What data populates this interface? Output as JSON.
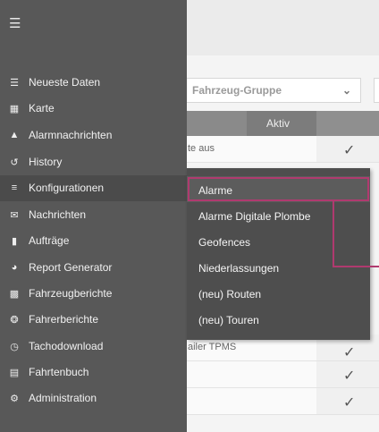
{
  "sidebar": {
    "menu_icon": "hamburger-icon",
    "items": [
      {
        "label": "Neueste Daten",
        "icon": "list-icon"
      },
      {
        "label": "Karte",
        "icon": "map-icon"
      },
      {
        "label": "Alarmnachrichten",
        "icon": "warning-icon"
      },
      {
        "label": "History",
        "icon": "history-icon"
      },
      {
        "label": "Konfigurationen",
        "icon": "sliders-icon"
      },
      {
        "label": "Nachrichten",
        "icon": "mail-icon"
      },
      {
        "label": "Aufträge",
        "icon": "document-icon"
      },
      {
        "label": "Report Generator",
        "icon": "pie-chart-icon"
      },
      {
        "label": "Fahrzeugberichte",
        "icon": "truck-icon"
      },
      {
        "label": "Fahrerberichte",
        "icon": "steering-wheel-icon"
      },
      {
        "label": "Tachodownload",
        "icon": "tacho-icon"
      },
      {
        "label": "Fahrtenbuch",
        "icon": "book-icon"
      },
      {
        "label": "Administration",
        "icon": "gear-icon"
      }
    ]
  },
  "submenu": {
    "items": [
      "Alarme",
      "Alarme Digitale Plombe",
      "Geofences",
      "Niederlassungen",
      "(neu) Routen",
      "(neu) Touren"
    ]
  },
  "background": {
    "filter_placeholder": "Fahrzeug-Gruppe",
    "column_header": "Aktiv",
    "row1_text": "te aus",
    "row2_text": "ailer TPMS",
    "check": "✓"
  },
  "colors": {
    "sidebar": "#585858",
    "submenu": "#4e4e4e",
    "highlight_border": "#b03a6f"
  }
}
